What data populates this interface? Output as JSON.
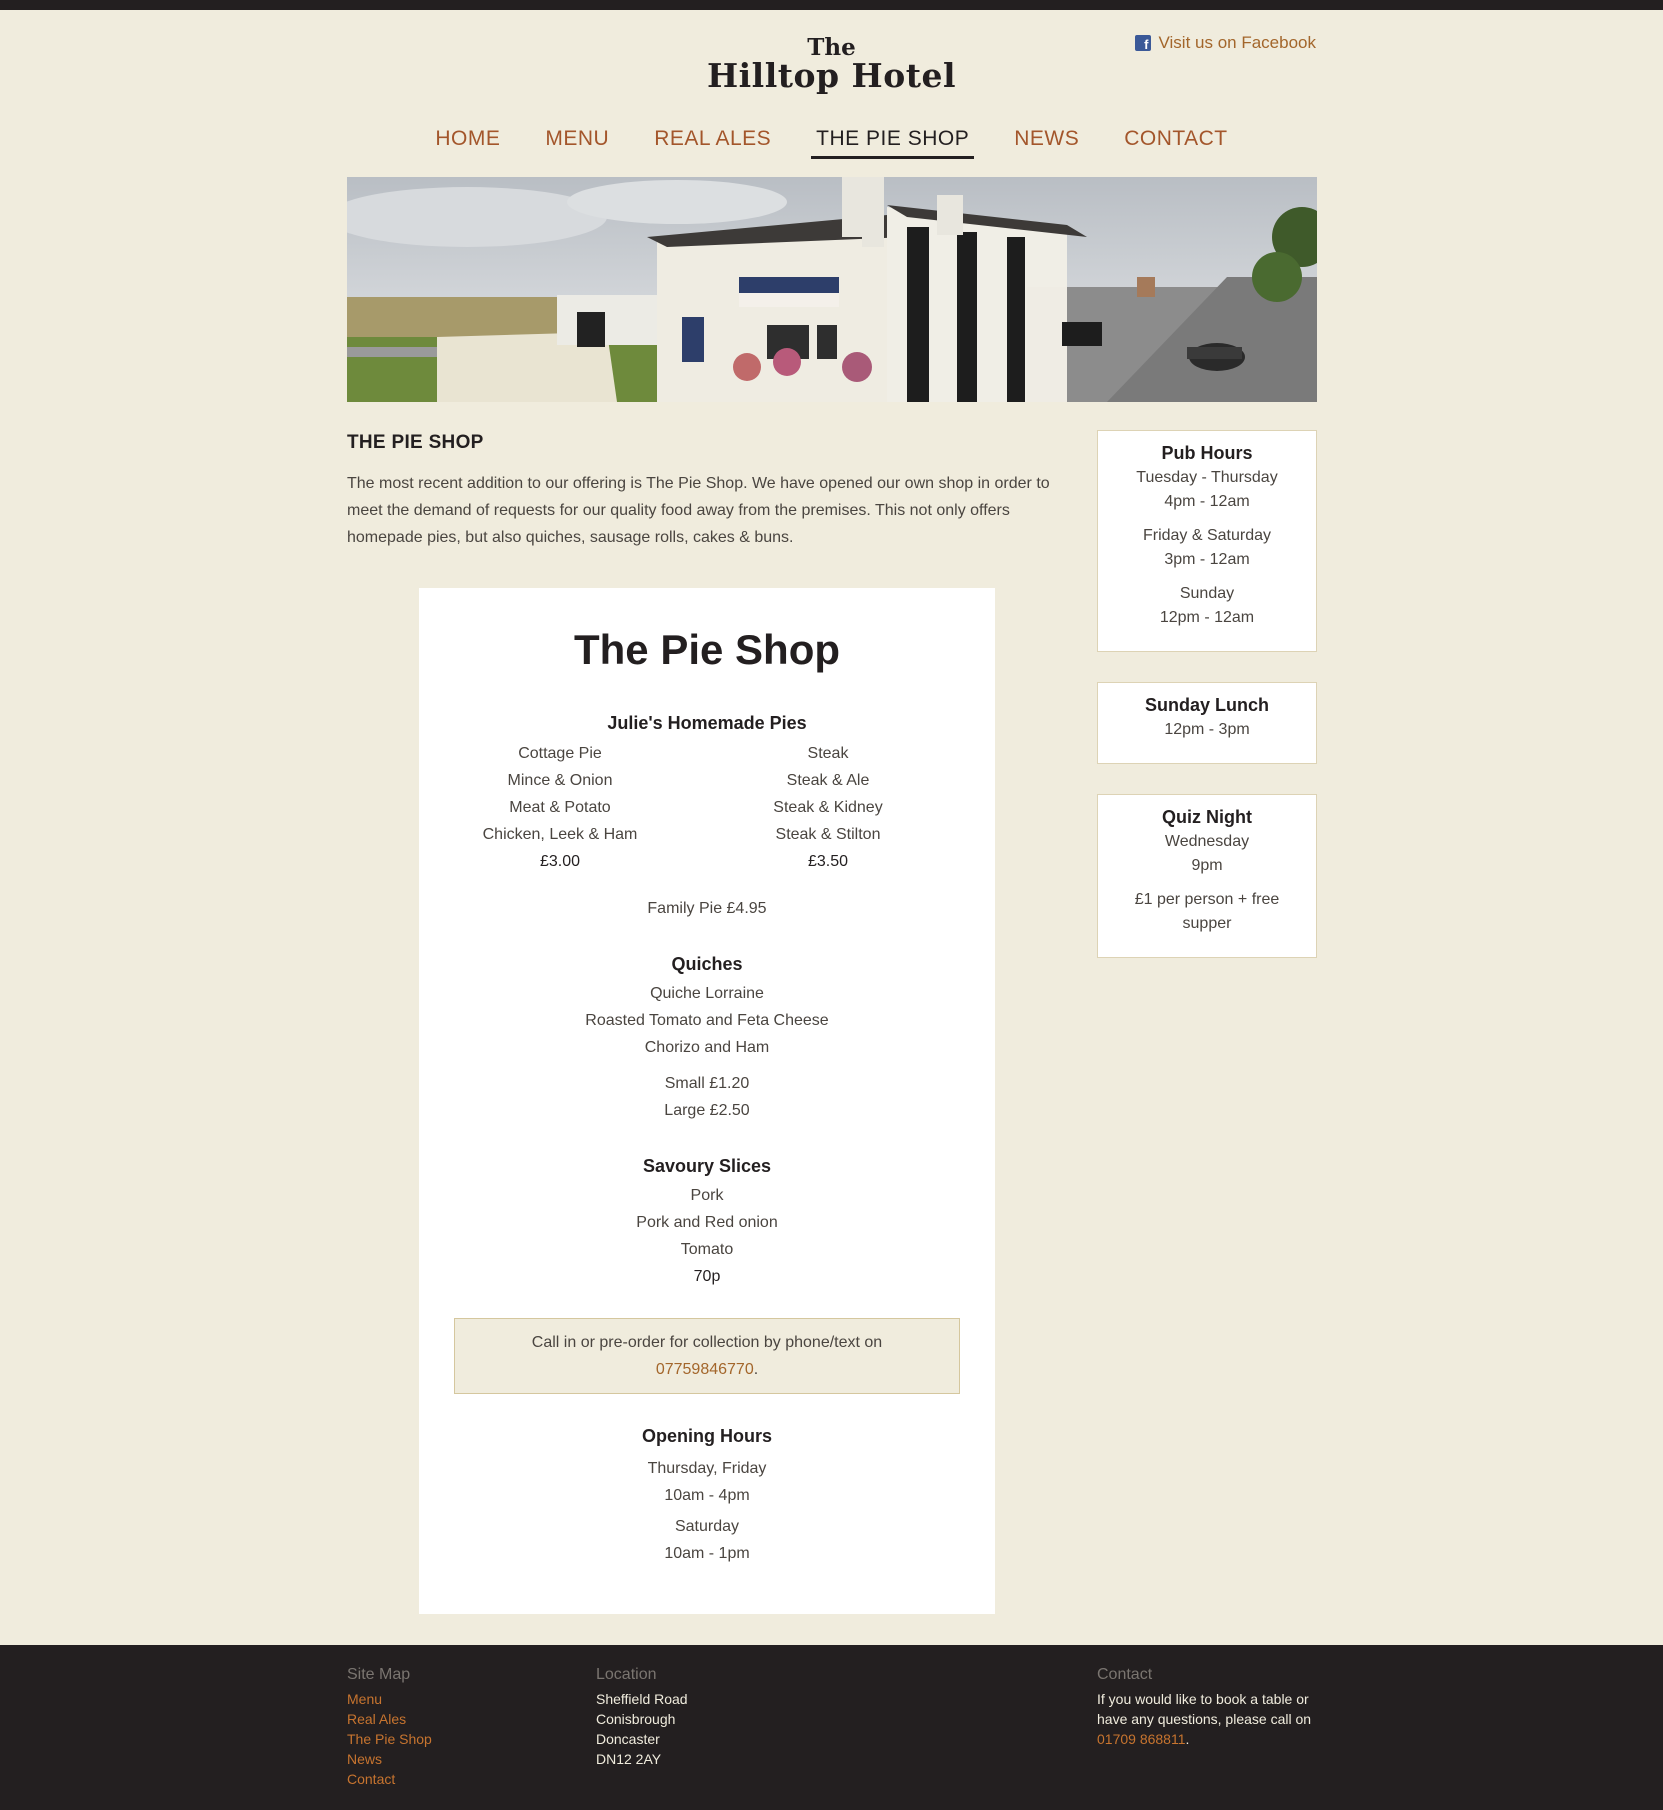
{
  "brand": {
    "the": "The",
    "name": "Hilltop Hotel"
  },
  "facebook": {
    "label": "Visit us on Facebook"
  },
  "nav": [
    "HOME",
    "MENU",
    "REAL ALES",
    "THE PIE SHOP",
    "NEWS",
    "CONTACT"
  ],
  "page": {
    "title": "THE PIE SHOP",
    "intro": "The most recent addition to our offering is The Pie Shop. We have opened our own shop in order to meet the demand of requests for our quality food away from the premises. This not only offers homepade pies, but also quiches, sausage rolls, cakes & buns."
  },
  "menu": {
    "title": "The Pie Shop",
    "pies": {
      "heading": "Julie's Homemade Pies",
      "left": [
        "Cottage Pie",
        "Mince & Onion",
        "Meat & Potato",
        "Chicken, Leek & Ham"
      ],
      "left_price": "£3.00",
      "right": [
        "Steak",
        "Steak & Ale",
        "Steak & Kidney",
        "Steak & Stilton"
      ],
      "right_price": "£3.50",
      "family": "Family Pie £4.95"
    },
    "quiches": {
      "heading": "Quiches",
      "items": [
        "Quiche Lorraine",
        "Roasted Tomato and Feta Cheese",
        "Chorizo and Ham"
      ],
      "small": "Small £1.20",
      "large": "Large £2.50"
    },
    "slices": {
      "heading": "Savoury Slices",
      "items": [
        "Pork",
        "Pork and Red onion",
        "Tomato"
      ],
      "price": "70p"
    },
    "callout": {
      "text": "Call in or pre-order for collection by phone/text on",
      "phone": "07759846770",
      "end": "."
    },
    "hours": {
      "heading": "Opening Hours",
      "days1": "Thursday, Friday",
      "time1": "10am - 4pm",
      "days2": "Saturday",
      "time2": "10am - 1pm"
    }
  },
  "sidebar": {
    "pub": {
      "title": "Pub Hours",
      "d1": "Tuesday - Thursday",
      "t1": "4pm - 12am",
      "d2": "Friday & Saturday",
      "t2": "3pm - 12am",
      "d3": "Sunday",
      "t3": "12pm - 12am"
    },
    "lunch": {
      "title": "Sunday Lunch",
      "t1": "12pm - 3pm"
    },
    "quiz": {
      "title": "Quiz Night",
      "d1": "Wednesday",
      "t1": "9pm",
      "note1": "£1 per person + free",
      "note2": "supper"
    }
  },
  "footer": {
    "sitemap": {
      "heading": "Site Map",
      "links": [
        "Menu",
        "Real Ales",
        "The Pie Shop",
        "News",
        "Contact"
      ]
    },
    "location": {
      "heading": "Location",
      "lines": [
        "Sheffield Road",
        "Conisbrough",
        "Doncaster",
        "DN12 2AY"
      ]
    },
    "contact": {
      "heading": "Contact",
      "line1": "If you would like to book a table or",
      "line2": "have any questions, please call on",
      "phone": "01709 868811",
      "end": "."
    }
  },
  "colors": {
    "background": "#f0ecdd",
    "accent": "#a3562b",
    "dark": "#231f20",
    "link_footer": "#c7742f"
  },
  "icons": {
    "facebook": "facebook-icon"
  }
}
